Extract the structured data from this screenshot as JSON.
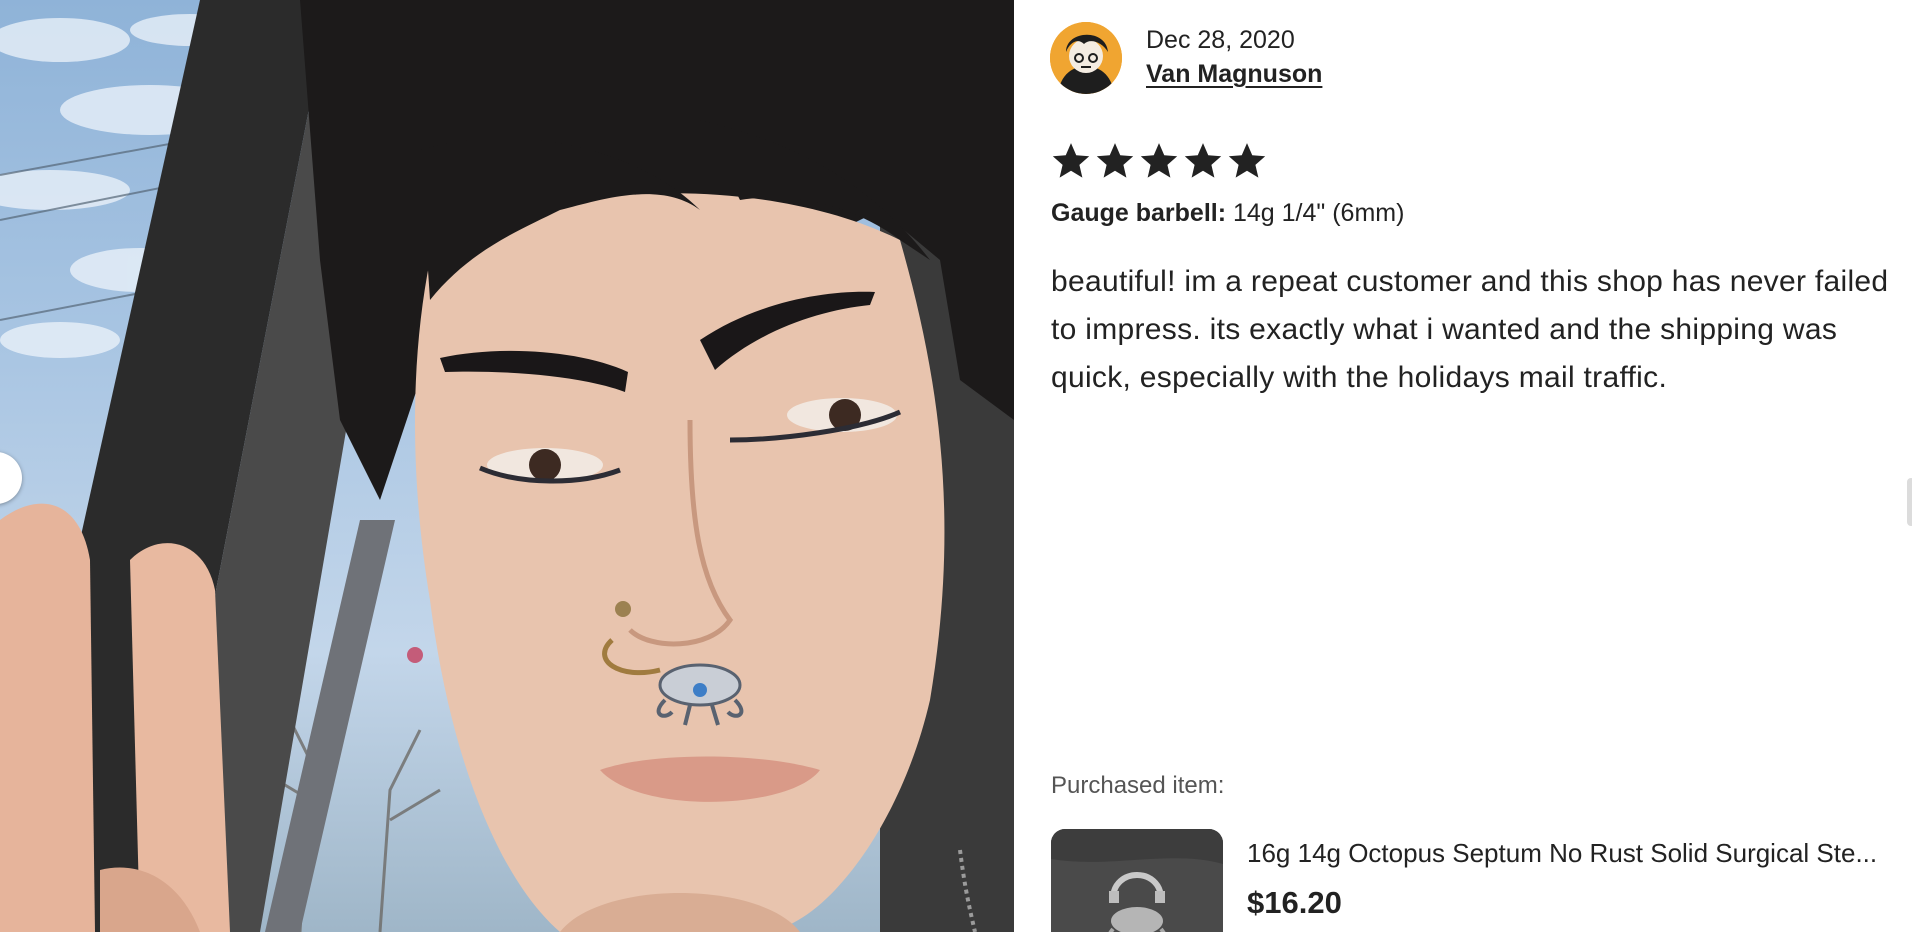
{
  "review": {
    "date": "Dec 28, 2020",
    "author": "Van Magnuson",
    "rating": 5,
    "variation_label": "Gauge barbell:",
    "variation_value": " 14g 1/4\" (6mm)",
    "text": "beautiful! im a repeat customer and this shop has never failed to impress. its exactly what i wanted and the shipping was quick, especially with the holidays mail traffic."
  },
  "purchase": {
    "label": "Purchased item:",
    "title": "16g 14g Octopus Septum No Rust Solid Surgical Ste...",
    "price": "$16.20"
  },
  "icons": {
    "star": "star-icon",
    "carousel_prev": "chevron-left-icon"
  },
  "colors": {
    "text": "#222222",
    "muted": "#555555",
    "avatar_bg": "#f0a531"
  }
}
